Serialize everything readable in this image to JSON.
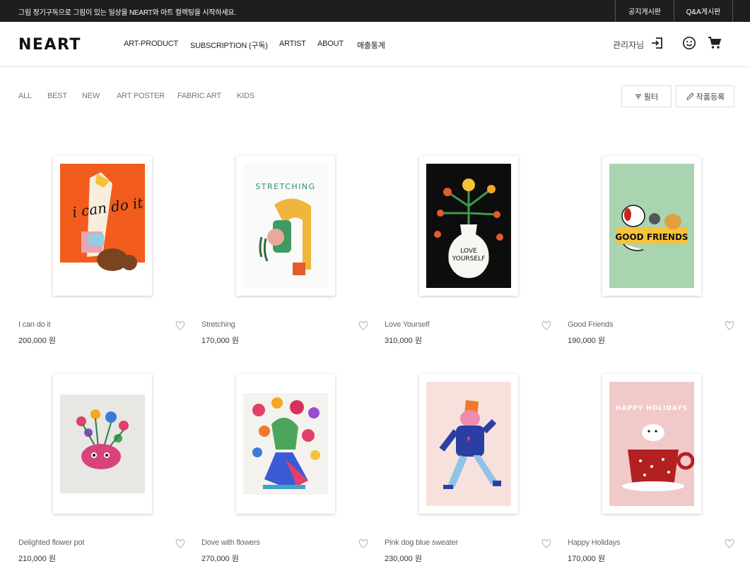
{
  "topbar": {
    "notice": "그림 정기구독으로 그림이 있는 일상을 NEART와 아트 컬렉팅을 시작하세요.",
    "notice_board": "공지게시판",
    "qa_board": "Q&A게시판"
  },
  "header": {
    "logo": "NEART",
    "nav": [
      "ART-PRODUCT",
      "SUBSCRIPTION (구독)",
      "ARTIST",
      "ABOUT",
      "매출통계"
    ],
    "admin_label": "관리자님"
  },
  "categories": [
    "ALL",
    "BEST",
    "NEW",
    "ART POSTER",
    "FABRIC ART",
    "KIDS"
  ],
  "buttons": {
    "filter": "필터",
    "register": "작품등록"
  },
  "products": [
    {
      "name": "I can do it",
      "price": "200,000 원"
    },
    {
      "name": "Stretching",
      "price": "170,000 원"
    },
    {
      "name": "Love Yourself",
      "price": "310,000 원"
    },
    {
      "name": "Good Friends",
      "price": "190,000 원"
    },
    {
      "name": "Delighted flower pot",
      "price": "210,000 원"
    },
    {
      "name": "Dove with flowers",
      "price": "270,000 원"
    },
    {
      "name": "Pink dog blue sweater",
      "price": "230,000 원"
    },
    {
      "name": "Happy Holidays",
      "price": "170,000 원"
    }
  ],
  "artwork_text": {
    "i_can_do_it": "i can do it",
    "stretching": "STRETCHING",
    "love_yourself_1": "LOVE",
    "love_yourself_2": "YOURSELF",
    "good_friends": "GOOD FRIENDS",
    "happy_holidays": "HAPPY HOLIDAYS"
  }
}
